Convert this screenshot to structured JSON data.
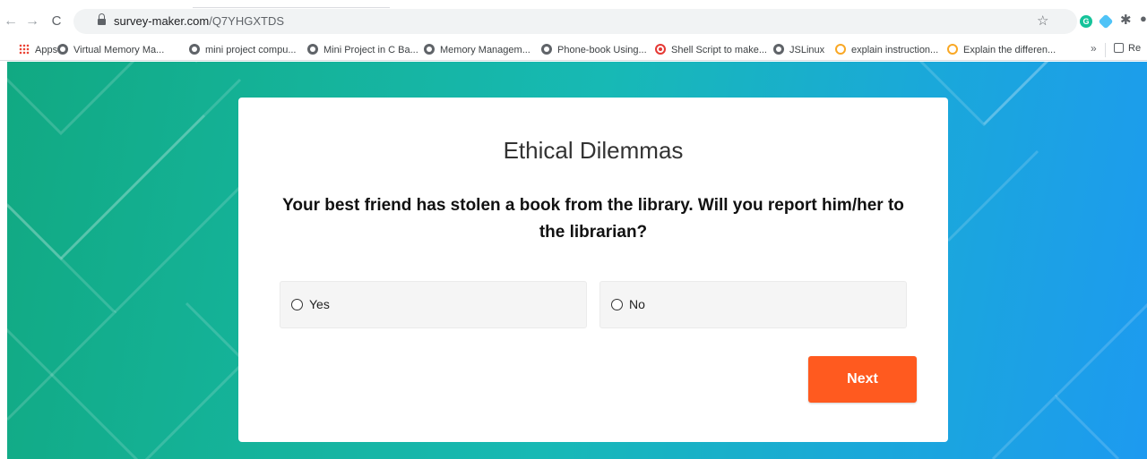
{
  "browser": {
    "url_domain": "survey-maker.com",
    "url_path": "/Q7YHGXTDS",
    "bookmarks": [
      {
        "label": "Apps",
        "icon": "apps-grid-icon"
      },
      {
        "label": "Virtual Memory Ma...",
        "icon": "globe-icon"
      },
      {
        "label": "mini project compu...",
        "icon": "globe-icon"
      },
      {
        "label": "Mini Project in C Ba...",
        "icon": "globe-icon"
      },
      {
        "label": "Memory Managem...",
        "icon": "globe-icon"
      },
      {
        "label": "Phone-book Using...",
        "icon": "globe-icon"
      },
      {
        "label": "Shell Script to make...",
        "icon": "target-icon"
      },
      {
        "label": "JSLinux",
        "icon": "globe-icon"
      },
      {
        "label": "explain instruction...",
        "icon": "quora-icon"
      },
      {
        "label": "Explain the differen...",
        "icon": "quora-icon"
      }
    ],
    "bookmarks_more": "»",
    "reading_list_label": "Re",
    "extension_grammarly": "G"
  },
  "survey": {
    "title": "Ethical Dilemmas",
    "question": "Your best friend has stolen a book from the library. Will you report him/her to the librarian?",
    "options": [
      {
        "label": "Yes"
      },
      {
        "label": "No"
      }
    ],
    "next_label": "Next"
  },
  "colors": {
    "accent_button": "#ff5a1f",
    "background_gradient_start": "#11a982",
    "background_gradient_end": "#1d9af0"
  }
}
